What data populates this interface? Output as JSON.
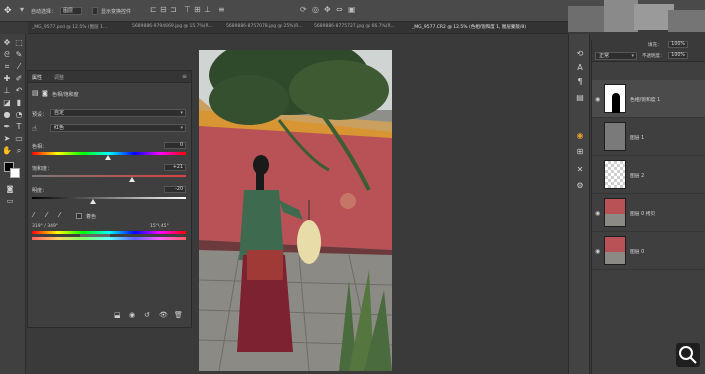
{
  "options_bar": {
    "tool_icon": "move-tool-icon",
    "auto_select_label": "自动选择：",
    "auto_select_value": "图层",
    "transform_label": "显示变换控件",
    "align_icons": [
      "align-left-icon",
      "align-center-icon",
      "align-right-icon",
      "align-top-icon",
      "align-middle-icon",
      "align-bottom-icon",
      "distribute-icon",
      "3d-mode-icon"
    ]
  },
  "tabs": [
    {
      "label": "_MG_9577.psd @ 12.5% (图层 1...",
      "active": false
    },
    {
      "label": "5689886-9794669.jpg @ 15.7%(R...",
      "active": false
    },
    {
      "label": "5689886-8757078.jpg @ 25%(R...",
      "active": false
    },
    {
      "label": "5689886-8775727.jpg @ 66.7%(R...",
      "active": false
    },
    {
      "label": "_MG_9577.CR2 @ 12.5% (色相/饱和度 1, 图层蒙版/8)",
      "active": true
    }
  ],
  "properties": {
    "tabs": [
      "属性",
      "调整"
    ],
    "adjustment_title": "色相/饱和度",
    "preset_label": "预设：",
    "preset_value": "自定",
    "channel_value": "红色",
    "hue_label": "色相：",
    "hue_value": "0",
    "saturation_label": "饱和度：",
    "saturation_value": "+21",
    "lightness_label": "明度：",
    "lightness_value": "-20",
    "colorize_label": "着色",
    "range_left": "319° / 349°",
    "range_right": "15°\\ 45°"
  },
  "layers": [
    {
      "name": "色相/饱和度 1",
      "thumb": "mask"
    },
    {
      "name": "图层 1",
      "thumb": "gray"
    },
    {
      "name": "图层 2",
      "thumb": "checker"
    },
    {
      "name": "图层 0 拷贝",
      "thumb": "photo"
    },
    {
      "name": "图层 0",
      "thumb": "photo"
    }
  ],
  "layers_header": {
    "blend_mode": "正常",
    "opacity_label": "不透明度：",
    "opacity_value": "100%",
    "fill_label": "填充：",
    "fill_value": "100%"
  },
  "colors": {
    "wall": "#b85256",
    "roof": "#d79534",
    "accent": "#c97f6a"
  }
}
